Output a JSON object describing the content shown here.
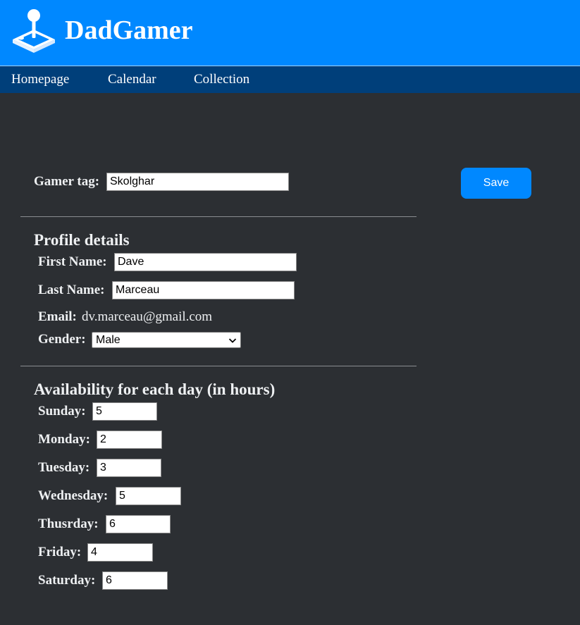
{
  "header": {
    "brand": "DadGamer",
    "logo_icon": "joystick-icon",
    "background_color": "#0088ff"
  },
  "nav": {
    "items": [
      {
        "label": "Homepage"
      },
      {
        "label": "Calendar"
      },
      {
        "label": "Collection"
      }
    ],
    "background_color": "#003f7a"
  },
  "gamer_tag": {
    "label": "Gamer tag:",
    "value": "Skolghar"
  },
  "save_button": {
    "label": "Save",
    "color": "#0088ff"
  },
  "profile": {
    "title": "Profile details",
    "first_name": {
      "label": "First Name:",
      "value": "Dave"
    },
    "last_name": {
      "label": "Last Name:",
      "value": "Marceau"
    },
    "email": {
      "label": "Email:",
      "value": "dv.marceau@gmail.com"
    },
    "gender": {
      "label": "Gender:",
      "value": "Male"
    }
  },
  "availability": {
    "title": "Availability for each day (in hours)",
    "days": [
      {
        "label": "Sunday:",
        "value": "5"
      },
      {
        "label": "Monday:",
        "value": "2"
      },
      {
        "label": "Tuesday:",
        "value": "3"
      },
      {
        "label": "Wednesday:",
        "value": "5"
      },
      {
        "label": "Thusrday:",
        "value": "6"
      },
      {
        "label": "Friday:",
        "value": "4"
      },
      {
        "label": "Saturday:",
        "value": "6"
      }
    ]
  }
}
